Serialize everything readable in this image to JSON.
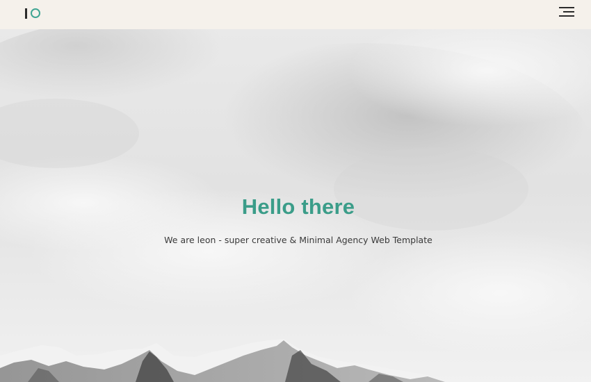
{
  "header": {
    "logo_icon": "leon-logo-icon",
    "menu_icon": "hamburger-menu-icon"
  },
  "hero": {
    "title": "Hello there",
    "subtitle": "We are leon - super creative & Minimal Agency Web Template",
    "background": "cloudy-sky-snow-mountains-image"
  },
  "colors": {
    "accent": "#3b9d89",
    "header_bg": "#f5f1eb",
    "text_dark": "#3a3a3a"
  }
}
